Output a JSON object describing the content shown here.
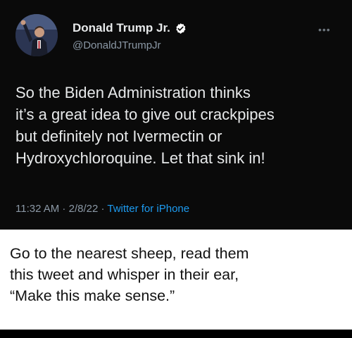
{
  "tweet": {
    "display_name": "Donald Trump Jr.",
    "handle": "@DonaldJTrumpJr",
    "verified_icon": "verified-badge-icon",
    "more_icon": "more-options-icon",
    "more_glyph": "•••",
    "text_lines": [
      "So the Biden Administration thinks",
      "it’s a great idea to give out crackpipes",
      "but definitely not Ivermectin or",
      "Hydroxychloroquine. Let that sink in!"
    ],
    "time": "11:32 AM",
    "separator": " · ",
    "date": "2/8/22",
    "source": "Twitter for iPhone"
  },
  "caption": {
    "lines": [
      "Go to the nearest sheep, read them",
      "this tweet and whisper in their ear,",
      "“Make this make sense.”"
    ]
  },
  "colors": {
    "tweet_bg": "#0a0a0a",
    "text": "#e7e9ea",
    "secondary": "#8b98a5",
    "link": "#1d9bf0",
    "caption_bg": "#ffffff"
  }
}
